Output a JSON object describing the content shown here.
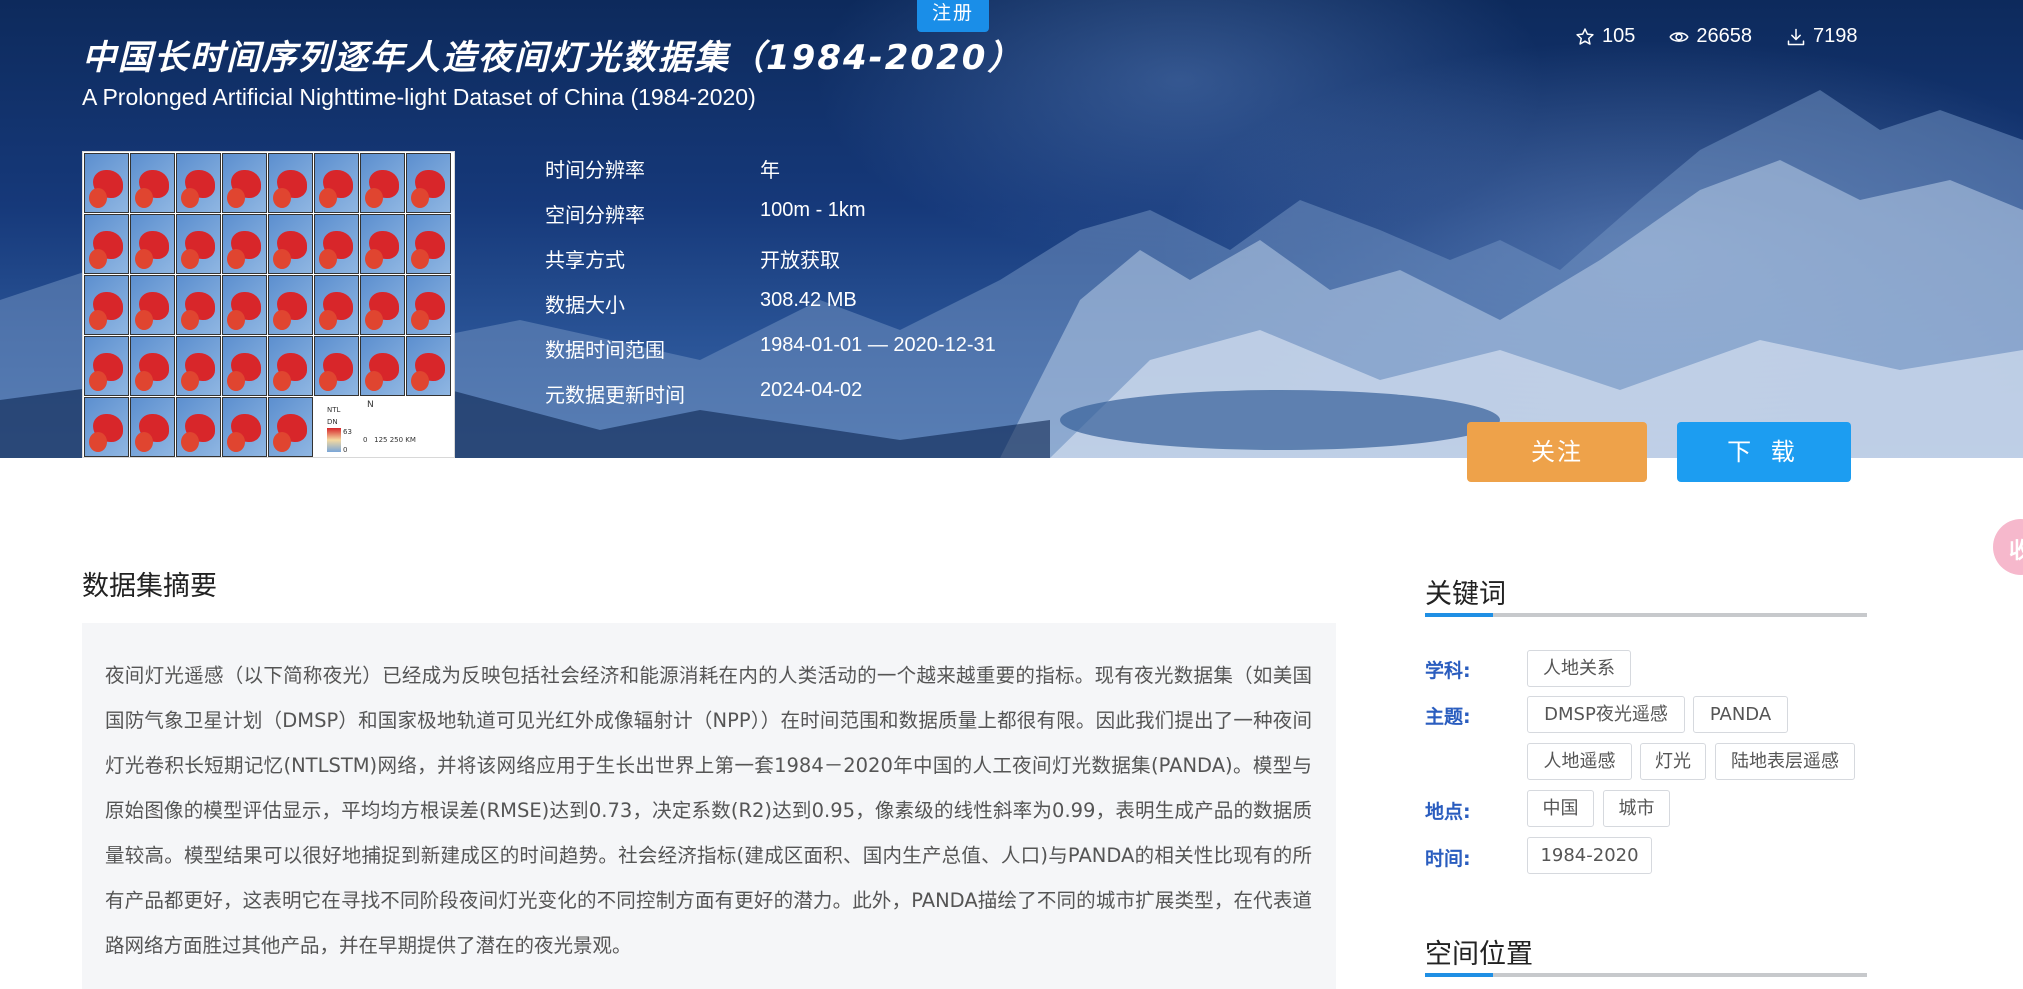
{
  "header": {
    "register_label": "注册",
    "title_cn": "中国长时间序列逐年人造夜间灯光数据集（1984-2020）",
    "title_en": "A Prolonged Artificial Nighttime-light Dataset of China (1984-2020)"
  },
  "stats": {
    "stars": "105",
    "views": "26658",
    "downloads": "7198",
    "icons": [
      "star-icon",
      "eye-icon",
      "download-icon"
    ]
  },
  "thumbnail": {
    "legend_title": "NTL",
    "legend_sub": "DN",
    "legend_max": "63",
    "legend_min": "0",
    "north": "N",
    "scale": "0   125 250 KM"
  },
  "meta": [
    {
      "label": "时间分辨率",
      "value": "年"
    },
    {
      "label": "空间分辨率",
      "value": "100m - 1km"
    },
    {
      "label": "共享方式",
      "value": "开放获取"
    },
    {
      "label": "数据大小",
      "value": "308.42 MB"
    },
    {
      "label": "数据时间范围",
      "value": "1984-01-01 — 2020-12-31"
    },
    {
      "label": "元数据更新时间",
      "value": "2024-04-02"
    }
  ],
  "actions": {
    "follow_label": "关注",
    "download_label": "下 载",
    "follow_color": "#eea24a",
    "download_color": "#1c9df1"
  },
  "floating": {
    "glyph": "收"
  },
  "abstract": {
    "title": "数据集摘要",
    "text": "夜间灯光遥感（以下简称夜光）已经成为反映包括社会经济和能源消耗在内的人类活动的一个越来越重要的指标。现有夜光数据集（如美国国防气象卫星计划（DMSP）和国家极地轨道可见光红外成像辐射计（NPP））在时间范围和数据质量上都很有限。因此我们提出了一种夜间灯光卷积长短期记忆(NTLSTM)网络，并将该网络应用于生长出世界上第一套1984－2020年中国的人工夜间灯光数据集(PANDA)。模型与原始图像的模型评估显示，平均均方根误差(RMSE)达到0.73，决定系数(R2)达到0.95，像素级的线性斜率为0.99，表明生成产品的数据质量较高。模型结果可以很好地捕捉到新建成区的时间趋势。社会经济指标(建成区面积、国内生产总值、人口)与PANDA的相关性比现有的所有产品都更好，这表明它在寻找不同阶段夜间灯光变化的不同控制方面有更好的潜力。此外，PANDA描绘了不同的城市扩展类型，在代表道路网络方面胜过其他产品，并在早期提供了潜在的夜光景观。"
  },
  "keywords": {
    "title": "关键词",
    "subject_label": "学科:",
    "subject_tags": [
      "人地关系"
    ],
    "theme_label": "主题:",
    "theme_tags": [
      "DMSP夜光遥感",
      "PANDA",
      "人地遥感",
      "灯光",
      "陆地表层遥感"
    ],
    "place_label": "地点:",
    "place_tags": [
      "中国",
      "城市"
    ],
    "time_label": "时间:",
    "time_tags": [
      "1984-2020"
    ]
  },
  "spatial": {
    "title": "空间位置"
  }
}
